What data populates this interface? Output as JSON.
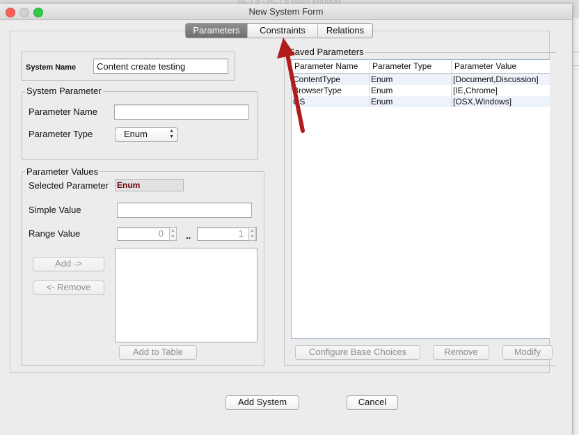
{
  "background_window": {
    "title": "ACTS - ACTS Main Window"
  },
  "window": {
    "title": "New System Form"
  },
  "tabs": [
    {
      "label": "Parameters",
      "active": true
    },
    {
      "label": "Constraints",
      "active": false
    },
    {
      "label": "Relations",
      "active": false
    }
  ],
  "system_name": {
    "label": "System Name",
    "value": "Content create testing"
  },
  "system_parameter": {
    "title": "System Parameter",
    "name_label": "Parameter Name",
    "name_value": "",
    "type_label": "Parameter Type",
    "type_value": "Enum"
  },
  "parameter_values": {
    "title": "Parameter Values",
    "selected_label": "Selected Parameter",
    "selected_value": "Enum",
    "simple_label": "Simple Value",
    "simple_value": "",
    "range_label": "Range Value",
    "range_from": "0",
    "range_sep": "..",
    "range_to": "1",
    "add_button": "Add ->",
    "remove_button": "<- Remove",
    "add_to_table_button": "Add to Table"
  },
  "saved_parameters": {
    "title": "Saved Parameters",
    "columns": [
      "Parameter Name",
      "Parameter Type",
      "Parameter Value"
    ],
    "rows": [
      [
        "ContentType",
        "Enum",
        "[Document,Discussion]"
      ],
      [
        "BrowserType",
        "Enum",
        "[IE,Chrome]"
      ],
      [
        "OS",
        "Enum",
        "[OSX,Windows]"
      ]
    ],
    "configure_button": "Configure Base Choices",
    "remove_button": "Remove",
    "modify_button": "Modify"
  },
  "footer": {
    "add_system_button": "Add System",
    "cancel_button": "Cancel"
  },
  "colors": {
    "arrow": "#b01c1c",
    "close": "#fc605c",
    "minimize": "#d0d0d0",
    "zoom": "#34c84a"
  }
}
